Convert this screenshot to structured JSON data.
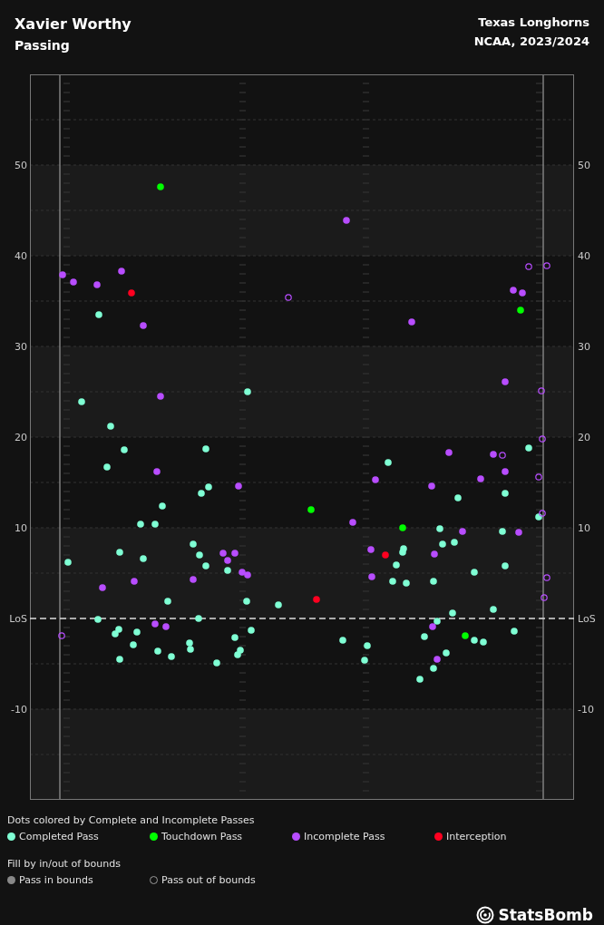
{
  "header": {
    "player": "Xavier Worthy",
    "category": "Passing",
    "team": "Texas Longhorns",
    "competition": "NCAA, 2023/2024"
  },
  "left_axis_labels": [
    "50",
    "40",
    "30",
    "20",
    "10",
    "LoS",
    "-10"
  ],
  "right_axis_labels": [
    "50",
    "40",
    "30",
    "20",
    "10",
    "LoS",
    "-10"
  ],
  "legend": {
    "color_title": "Dots colored by Complete and Incomplete Passes",
    "color_items": [
      {
        "label": "Completed Pass",
        "color": "#7fffd4"
      },
      {
        "label": "Touchdown Pass",
        "color": "#00ff00"
      },
      {
        "label": "Incomplete Pass",
        "color": "#b84dff"
      },
      {
        "label": "Interception",
        "color": "#ff0020"
      }
    ],
    "fill_title": "Fill by in/out of bounds",
    "fill_items": [
      {
        "label": "Pass in bounds",
        "kind": "filled"
      },
      {
        "label": "Pass out of bounds",
        "kind": "open"
      }
    ]
  },
  "brand": "StatsBomb"
}
